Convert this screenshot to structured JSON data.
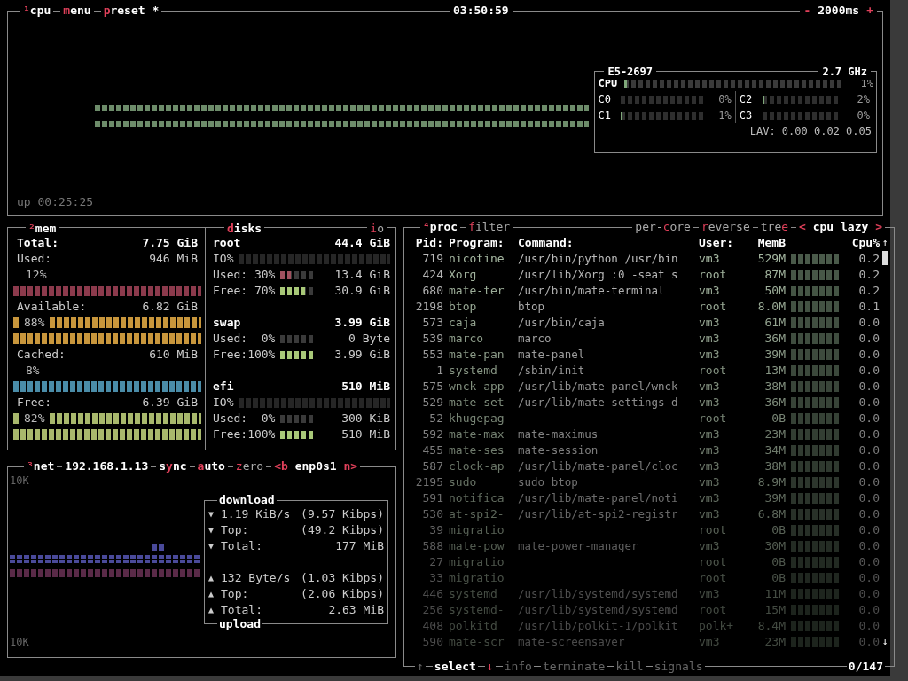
{
  "cpu": {
    "tabs": [
      {
        "accent": "¹",
        "text": "cpu"
      },
      {
        "accent": "m",
        "text": "enu"
      },
      {
        "accent": "p",
        "text": "reset *"
      }
    ],
    "clock": "03:50:59",
    "interval": {
      "minus": "-",
      "value": "2000ms",
      "plus": "+"
    },
    "uptime": "up 00:25:25",
    "info": {
      "model": "E5-2697",
      "freq": "2.7 GHz",
      "total": {
        "label": "CPU",
        "level": 0.01,
        "reading": "1%"
      },
      "cores": [
        {
          "label": "C0",
          "level": 0,
          "reading": "0%"
        },
        {
          "label": "C2",
          "level": 0.02,
          "reading": "2%"
        },
        {
          "label": "C1",
          "level": 0.01,
          "reading": "1%"
        },
        {
          "label": "C3",
          "level": 0,
          "reading": "0%"
        }
      ],
      "lav": "LAV: 0.00 0.02 0.05"
    }
  },
  "mem": {
    "tab": {
      "accent": "²",
      "text": "mem"
    },
    "total": {
      "label": "Total:",
      "value": "7.75 GiB"
    },
    "rows": [
      {
        "kind": "split",
        "label": "Used:",
        "value": "946 MiB",
        "percent": "12%",
        "color": "#8c3a4c"
      },
      {
        "kind": "inline",
        "label": "Available:",
        "value": "6.82 GiB",
        "percent": "88%",
        "color": "#c8963c"
      },
      {
        "kind": "split",
        "label": "Cached:",
        "value": "610 MiB",
        "percent": "8%",
        "color": "#4a8ca8"
      },
      {
        "kind": "inline",
        "label": "Free:",
        "value": "6.39 GiB",
        "percent": "82%",
        "color": "#a8b86c"
      }
    ]
  },
  "disks": {
    "tab": {
      "accent": "d",
      "text": "isks"
    },
    "io_tab": {
      "accent": "i",
      "text": "o"
    },
    "items": [
      {
        "name": "root",
        "total": "44.4 GiB",
        "rows": [
          {
            "kind": "io",
            "label": "IO%"
          },
          {
            "kind": "used",
            "label": "Used: 30%",
            "level": 0.3,
            "value": "13.4 GiB"
          },
          {
            "kind": "free",
            "label": "Free: 70%",
            "level": 0.7,
            "value": "30.9 GiB"
          }
        ]
      },
      {
        "name": "swap",
        "total": "3.99 GiB",
        "rows": [
          {
            "kind": "used",
            "label": "Used:  0%",
            "level": 0,
            "value": "0 Byte"
          },
          {
            "kind": "free",
            "label": "Free:100%",
            "level": 1,
            "value": "3.99 GiB"
          }
        ]
      },
      {
        "name": "efi",
        "total": "510 MiB",
        "rows": [
          {
            "kind": "io",
            "label": "IO%"
          },
          {
            "kind": "used",
            "label": "Used:  0%",
            "level": 0,
            "value": "300 KiB"
          },
          {
            "kind": "free",
            "label": "Free:100%",
            "level": 1,
            "value": "510 MiB"
          }
        ]
      }
    ]
  },
  "net": {
    "tabs": [
      {
        "accent": "³",
        "text": "net"
      },
      {
        "text": "192.168.1.13"
      },
      {
        "text": "s",
        "accent2": "y",
        "text2": "nc"
      },
      {
        "accent": "a",
        "text": "uto"
      },
      {
        "accent": "z",
        "text": "ero"
      },
      {
        "accent": "<b",
        "text": " enp0s1 ",
        "accent2": "n>"
      }
    ],
    "scale_top": "10K",
    "scale_bottom": "10K",
    "download": {
      "title": "download",
      "rows": [
        {
          "arrow": "▼",
          "label": "1.19 KiB/s",
          "value": "(9.57 Kibps)"
        },
        {
          "arrow": "▼",
          "label": "Top:",
          "value": "(49.2 Kibps)"
        },
        {
          "arrow": "▼",
          "label": "Total:",
          "value": "177 MiB"
        }
      ]
    },
    "upload": {
      "title": "upload",
      "rows": [
        {
          "arrow": "▲",
          "label": "132 Byte/s",
          "value": "(1.03 Kibps)"
        },
        {
          "arrow": "▲",
          "label": "Top:",
          "value": "(2.06 Kibps)"
        },
        {
          "arrow": "▲",
          "label": "Total:",
          "value": "2.63 MiB"
        }
      ]
    }
  },
  "proc": {
    "tabs": [
      {
        "accent": "⁴",
        "text": "proc"
      },
      {
        "accent": "f",
        "text": "ilter"
      },
      {
        "text": "per-",
        "accent2": "c",
        "text2": "ore"
      },
      {
        "accent": "r",
        "text": "everse"
      },
      {
        "text": "tre",
        "accent2": "e"
      },
      {
        "accent": "<",
        "text": " cpu lazy ",
        "accent2": ">"
      }
    ],
    "columns": [
      "Pid:",
      "Program:",
      "Command:",
      "User:",
      "MemB",
      "Cpu%"
    ],
    "rows": [
      {
        "pid": "719",
        "program": "nicotine",
        "command": "/usr/bin/python /usr/bin",
        "user": "vm3",
        "mem": "529M",
        "cpu": "0.2"
      },
      {
        "pid": "424",
        "program": "Xorg",
        "command": "/usr/lib/Xorg :0 -seat s",
        "user": "root",
        "mem": "87M",
        "cpu": "0.2"
      },
      {
        "pid": "680",
        "program": "mate-ter",
        "command": "/usr/bin/mate-terminal",
        "user": "vm3",
        "mem": "50M",
        "cpu": "0.2"
      },
      {
        "pid": "2198",
        "program": "btop",
        "command": "btop",
        "user": "root",
        "mem": "8.0M",
        "cpu": "0.1"
      },
      {
        "pid": "573",
        "program": "caja",
        "command": "/usr/bin/caja",
        "user": "vm3",
        "mem": "61M",
        "cpu": "0.0"
      },
      {
        "pid": "539",
        "program": "marco",
        "command": "marco",
        "user": "vm3",
        "mem": "36M",
        "cpu": "0.0"
      },
      {
        "pid": "553",
        "program": "mate-pan",
        "command": "mate-panel",
        "user": "vm3",
        "mem": "39M",
        "cpu": "0.0"
      },
      {
        "pid": "1",
        "program": "systemd",
        "command": "/sbin/init",
        "user": "root",
        "mem": "13M",
        "cpu": "0.0"
      },
      {
        "pid": "575",
        "program": "wnck-app",
        "command": "/usr/lib/mate-panel/wnck",
        "user": "vm3",
        "mem": "38M",
        "cpu": "0.0"
      },
      {
        "pid": "529",
        "program": "mate-set",
        "command": "/usr/lib/mate-settings-d",
        "user": "vm3",
        "mem": "36M",
        "cpu": "0.0"
      },
      {
        "pid": "52",
        "program": "khugepag",
        "command": "",
        "user": "root",
        "mem": "0B",
        "cpu": "0.0"
      },
      {
        "pid": "592",
        "program": "mate-max",
        "command": "mate-maximus",
        "user": "vm3",
        "mem": "23M",
        "cpu": "0.0"
      },
      {
        "pid": "455",
        "program": "mate-ses",
        "command": "mate-session",
        "user": "vm3",
        "mem": "34M",
        "cpu": "0.0"
      },
      {
        "pid": "587",
        "program": "clock-ap",
        "command": "/usr/lib/mate-panel/cloc",
        "user": "vm3",
        "mem": "38M",
        "cpu": "0.0"
      },
      {
        "pid": "2195",
        "program": "sudo",
        "command": "sudo btop",
        "user": "vm3",
        "mem": "8.9M",
        "cpu": "0.0"
      },
      {
        "pid": "591",
        "program": "notifica",
        "command": "/usr/lib/mate-panel/noti",
        "user": "vm3",
        "mem": "39M",
        "cpu": "0.0"
      },
      {
        "pid": "530",
        "program": "at-spi2-",
        "command": "/usr/lib/at-spi2-registr",
        "user": "vm3",
        "mem": "6.8M",
        "cpu": "0.0"
      },
      {
        "pid": "39",
        "program": "migratio",
        "command": "",
        "user": "root",
        "mem": "0B",
        "cpu": "0.0"
      },
      {
        "pid": "588",
        "program": "mate-pow",
        "command": "mate-power-manager",
        "user": "vm3",
        "mem": "30M",
        "cpu": "0.0"
      },
      {
        "pid": "27",
        "program": "migratio",
        "command": "",
        "user": "root",
        "mem": "0B",
        "cpu": "0.0"
      },
      {
        "pid": "33",
        "program": "migratio",
        "command": "",
        "user": "root",
        "mem": "0B",
        "cpu": "0.0"
      },
      {
        "pid": "446",
        "program": "systemd",
        "command": "/usr/lib/systemd/systemd",
        "user": "vm3",
        "mem": "11M",
        "cpu": "0.0"
      },
      {
        "pid": "256",
        "program": "systemd-",
        "command": "/usr/lib/systemd/systemd",
        "user": "root",
        "mem": "15M",
        "cpu": "0.0"
      },
      {
        "pid": "408",
        "program": "polkitd",
        "command": "/usr/lib/polkit-1/polkit",
        "user": "polk+",
        "mem": "8.4M",
        "cpu": "0.0"
      },
      {
        "pid": "590",
        "program": "mate-scr",
        "command": "mate-screensaver",
        "user": "vm3",
        "mem": "23M",
        "cpu": "0.0"
      }
    ],
    "scroll_up": "↑",
    "scroll_down": "↓",
    "footer": [
      {
        "kind": "arrow",
        "text": "↑"
      },
      {
        "kind": "active",
        "text": "select"
      },
      {
        "kind": "accent",
        "text": "↓"
      },
      {
        "kind": "dim",
        "text": "info"
      },
      {
        "kind": "dim",
        "text": "terminate"
      },
      {
        "kind": "dim",
        "text": "kill"
      },
      {
        "kind": "dim",
        "text": "signals"
      }
    ],
    "count": "0/147"
  }
}
